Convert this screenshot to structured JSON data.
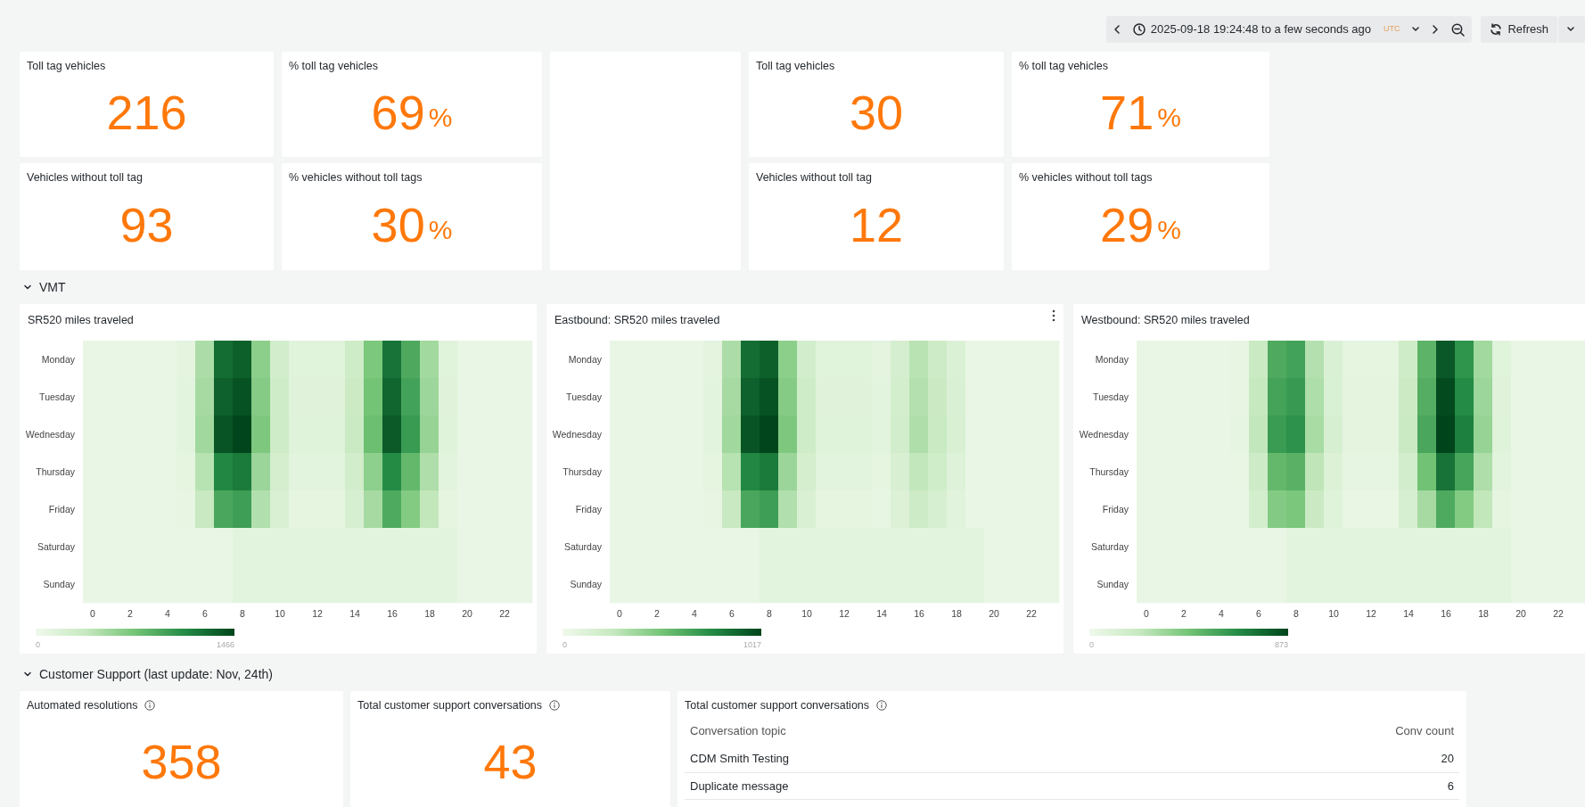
{
  "toolbar": {
    "time_range": "2025-09-18 19:24:48 to a few seconds ago",
    "timezone": "UTC",
    "refresh": "Refresh"
  },
  "stat_groups": [
    {
      "panels": [
        {
          "title": "Toll tag vehicles",
          "value": "216"
        },
        {
          "title": "% toll tag vehicles",
          "value": "69",
          "unit": "%"
        },
        {
          "title": "Vehicles without toll tag",
          "value": "93"
        },
        {
          "title": "% vehicles without toll tags",
          "value": "30",
          "unit": "%"
        }
      ]
    },
    {
      "panels": [
        {
          "title": "Toll tag vehicles",
          "value": "30"
        },
        {
          "title": "% toll tag vehicles",
          "value": "71",
          "unit": "%"
        },
        {
          "title": "Vehicles without toll tag",
          "value": "12"
        },
        {
          "title": "% vehicles without toll tags",
          "value": "29",
          "unit": "%"
        }
      ]
    }
  ],
  "vmt_row": {
    "title": "VMT",
    "expanded": true,
    "heatmaps": [
      {
        "title": "SR520 miles traveled",
        "menu_visible": false,
        "y_labels": [
          "Monday",
          "Tuesday",
          "Wednesday",
          "Thursday",
          "Friday",
          "Saturday",
          "Sunday"
        ],
        "x_ticks": [
          "0",
          "2",
          "4",
          "6",
          "8",
          "10",
          "12",
          "14",
          "16",
          "18",
          "20",
          "22"
        ],
        "scale_min": "0",
        "scale_max": "1466"
      },
      {
        "title": "Eastbound: SR520 miles traveled",
        "menu_visible": true,
        "y_labels": [
          "Monday",
          "Tuesday",
          "Wednesday",
          "Thursday",
          "Friday",
          "Saturday",
          "Sunday"
        ],
        "x_ticks": [
          "0",
          "2",
          "4",
          "6",
          "8",
          "10",
          "12",
          "14",
          "16",
          "18",
          "20",
          "22"
        ],
        "scale_min": "0",
        "scale_max": "1017"
      },
      {
        "title": "Westbound: SR520 miles traveled",
        "menu_visible": false,
        "y_labels": [
          "Monday",
          "Tuesday",
          "Wednesday",
          "Thursday",
          "Friday",
          "Saturday",
          "Sunday"
        ],
        "x_ticks": [
          "0",
          "2",
          "4",
          "6",
          "8",
          "10",
          "12",
          "14",
          "16",
          "18",
          "20",
          "22"
        ],
        "scale_min": "0",
        "scale_max": "873"
      }
    ]
  },
  "support_row": {
    "title": "Customer Support (last update: Nov, 24th)",
    "expanded": true,
    "stats": [
      {
        "title": "Automated resolutions",
        "value": "358"
      },
      {
        "title": "Total customer support conversations",
        "value": "43"
      }
    ],
    "table": {
      "title": "Total customer support conversations",
      "columns": [
        "Conversation topic",
        "Conv count"
      ],
      "rows": [
        [
          "CDM Smith Testing",
          "20"
        ],
        [
          "Duplicate message",
          "6"
        ]
      ]
    }
  }
}
